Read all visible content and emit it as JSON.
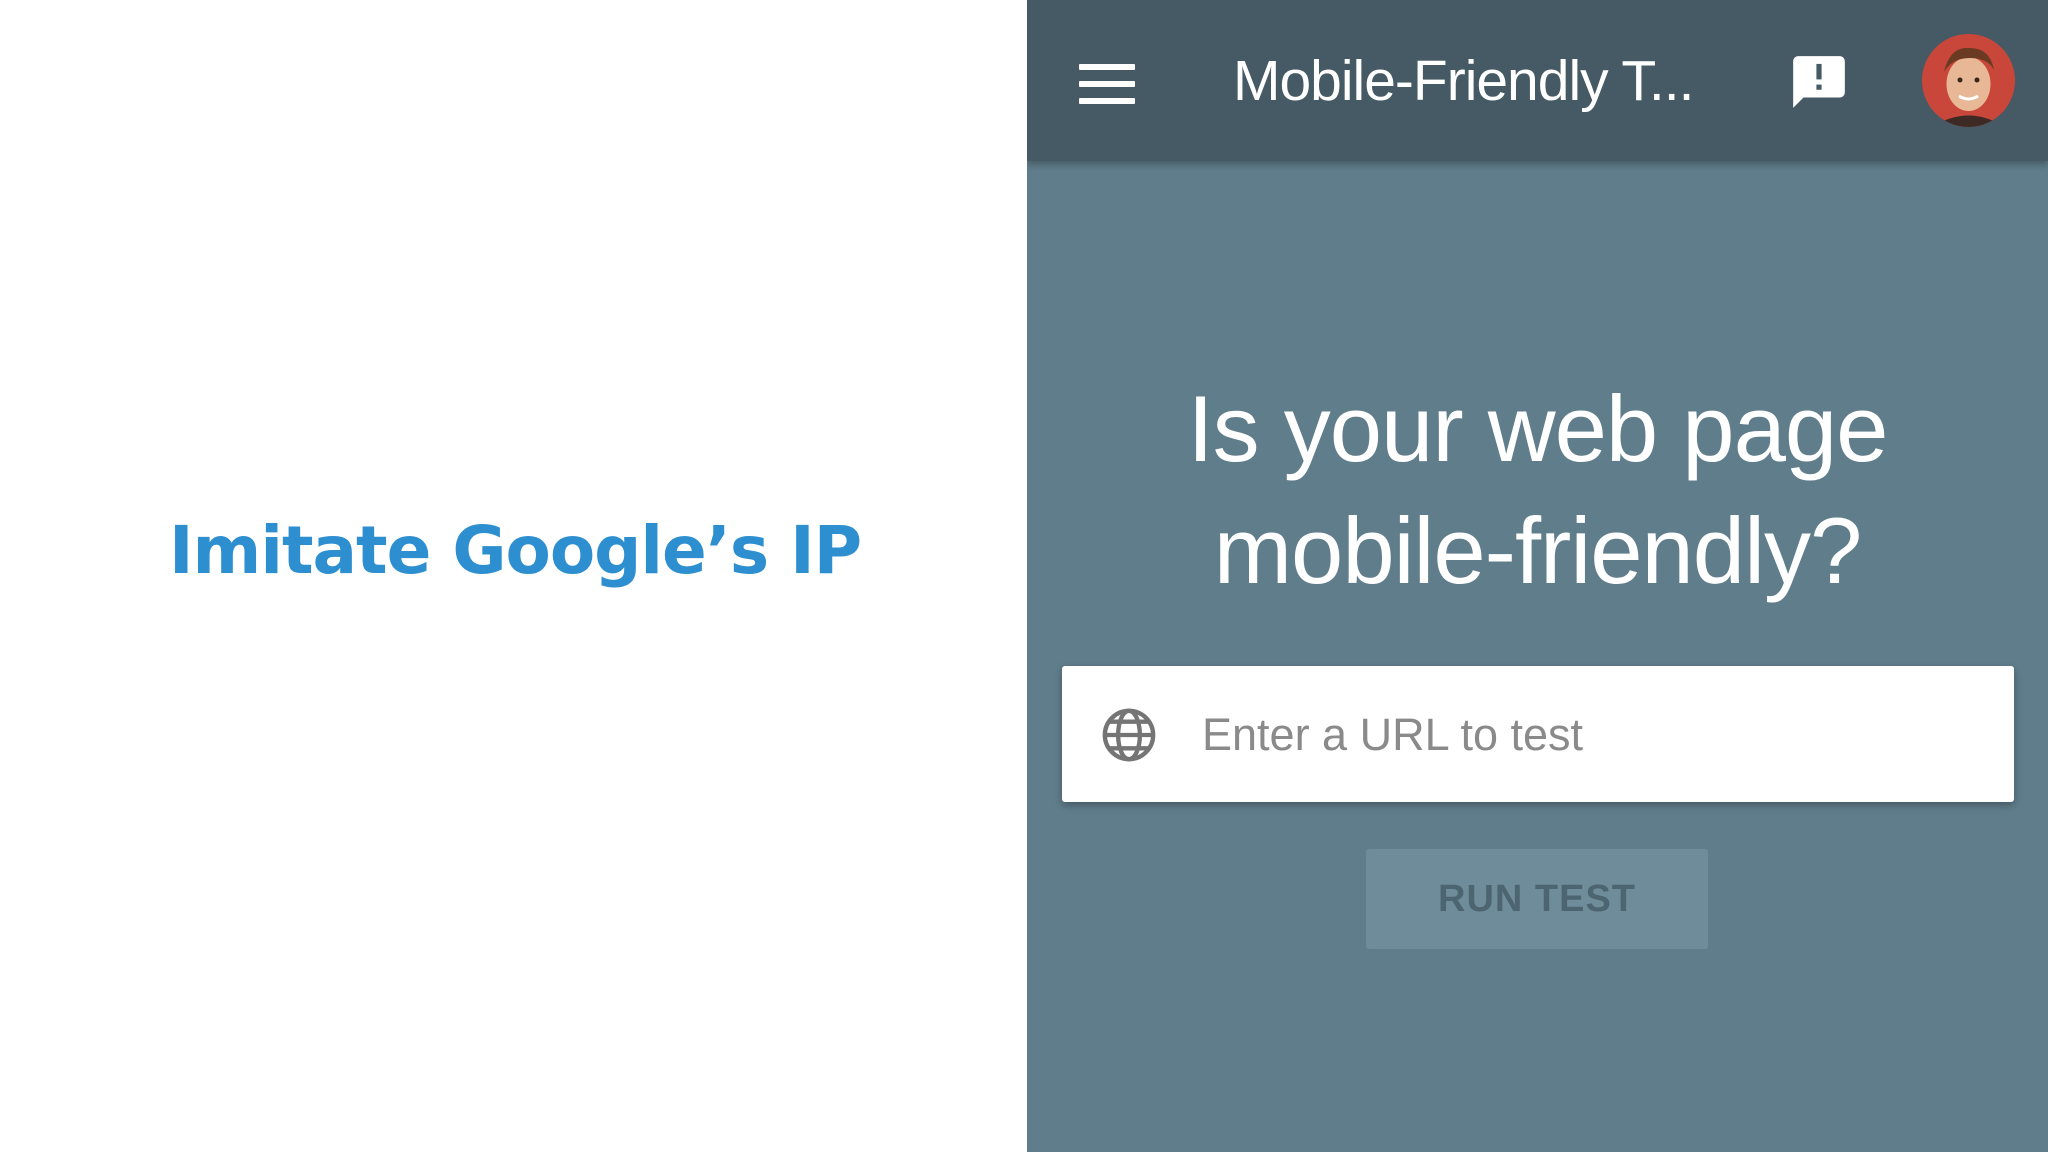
{
  "slide": {
    "title": "Imitate Google’s IP"
  },
  "app": {
    "title": "Mobile-Friendly T...",
    "icons": {
      "menu": "menu-icon",
      "feedback": "feedback-icon",
      "avatar": "avatar",
      "globe": "globe-icon"
    },
    "colors": {
      "appbar": "#455a64",
      "background": "#607d8b",
      "slide_title": "#2d8fd0"
    }
  },
  "main": {
    "headline_line1": "Is your web page",
    "headline_line2": "mobile-friendly?",
    "url_placeholder": "Enter a URL to test",
    "run_button_label": "RUN TEST"
  }
}
